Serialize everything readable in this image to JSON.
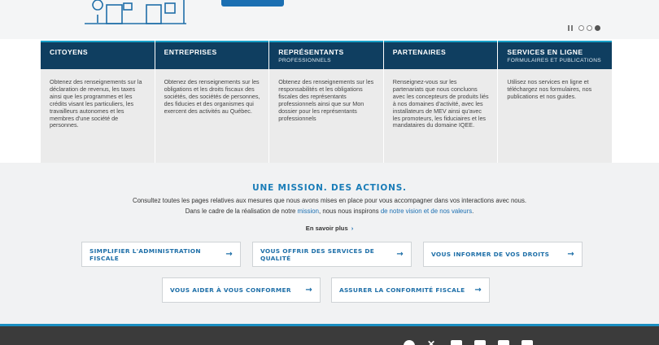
{
  "hero": {
    "button_label": "",
    "carousel": {
      "slides": 3,
      "active": 3
    }
  },
  "cards": [
    {
      "title": "CITOYENS",
      "subtitle": "",
      "body": "Obtenez des renseignements sur la déclaration de revenus, les taxes ainsi que les programmes et les crédits visant les particuliers, les travailleurs autonomes et les membres d'une société de personnes."
    },
    {
      "title": "ENTREPRISES",
      "subtitle": "",
      "body": "Obtenez des renseignements sur les obligations et les droits fiscaux des sociétés, des sociétés de personnes, des fiducies et des organismes qui exercent des activités au Québec."
    },
    {
      "title": "REPRÉSENTANTS",
      "subtitle": "PROFESSIONNELS",
      "body": "Obtenez des renseignements sur les responsabilités et les obligations fiscales des représentants professionnels ainsi que sur Mon dossier pour les représentants professionnels"
    },
    {
      "title": "PARTENAIRES",
      "subtitle": "",
      "body": "Renseignez-vous sur les partenariats que nous concluons avec les concepteurs de produits liés à nos domaines d'activité, avec les installateurs de MEV ainsi qu'avec les promoteurs, les fiduciaires et les mandataires du domaine IQEE."
    },
    {
      "title": "SERVICES EN LIGNE",
      "subtitle": "FORMULAIRES ET PUBLICATIONS",
      "body": "Utilisez nos services en ligne et téléchargez nos formulaires, nos publications et nos guides."
    }
  ],
  "mission": {
    "title": "UNE MISSION. DES ACTIONS.",
    "line1": "Consultez toutes les pages relatives aux mesures que nous avons mises en place pour vous accompagner dans vos interactions avec nous.",
    "line2_pre": "Dans le cadre de la réalisation de notre ",
    "line2_link1": "mission",
    "line2_mid": ", nous nous inspirons ",
    "line2_link2": "de notre vision et de nos valeurs",
    "line2_post": ".",
    "more_label": "En savoir plus",
    "buttons": [
      "SIMPLIFIER L'ADMINISTRATION FISCALE",
      "VOUS OFFRIR DES SERVICES DE QUALITÉ",
      "VOUS INFORMER DE VOS DROITS",
      "VOUS AIDER À VOUS CONFORMER",
      "ASSURER LA CONFORMITÉ FISCALE"
    ]
  },
  "colors": {
    "card_header": "#0f3e60",
    "accent": "#18a0c8",
    "link": "#1b6fb2",
    "footer": "#3b3b3b"
  },
  "icons": {
    "arrow": "→",
    "chevron": "›",
    "social": [
      "facebook-icon",
      "x-icon",
      "linkedin-icon",
      "youtube-icon",
      "email-icon",
      "rss-icon"
    ]
  }
}
